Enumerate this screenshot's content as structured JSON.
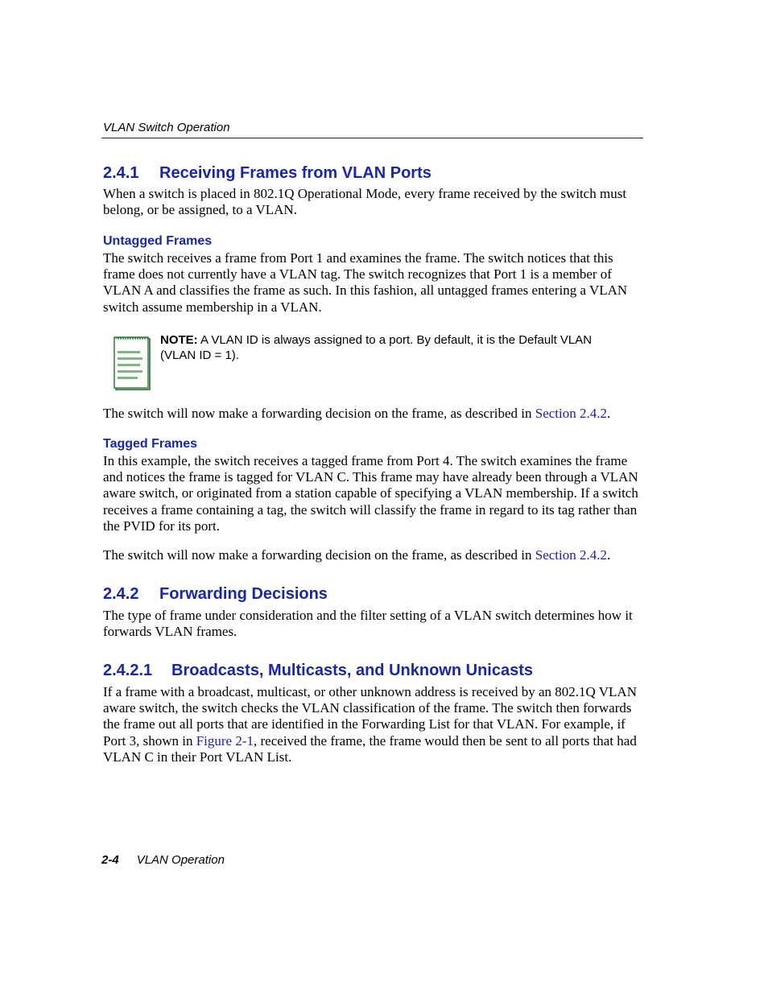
{
  "running_header": "VLAN Switch Operation",
  "section_241": {
    "number": "2.4.1",
    "title": "Receiving Frames from VLAN Ports",
    "paragraph": [
      "When a switch is placed in 802.1Q Operational Mode, every frame received by the switch must",
      "belong, or be assigned, to a VLAN."
    ]
  },
  "untagged": {
    "title": "Untagged Frames",
    "paragraph": [
      "The switch receives a frame from Port 1 and examines the frame. The switch notices that this",
      "frame does not currently have a VLAN tag. The switch recognizes that Port 1 is a member of",
      "VLAN A and classifies the frame as such. In this fashion, all untagged frames entering a VLAN",
      "switch assume membership in a VLAN."
    ],
    "note": {
      "label": "NOTE:",
      "line1": " A VLAN ID is always assigned to a port. By default, it is the Default VLAN",
      "line2": "(VLAN ID = 1)."
    },
    "followup_prefix": "The switch will now make a forwarding decision on the frame, as described in ",
    "followup_link": "Section 2.4.2",
    "followup_suffix": "."
  },
  "tagged": {
    "title": "Tagged Frames",
    "paragraph": [
      "In this example, the switch receives a tagged frame from Port 4. The switch examines the frame",
      "and notices the frame is tagged for VLAN C. This frame may have already been through a VLAN",
      "aware switch, or originated from a station capable of specifying a VLAN membership. If a switch",
      "receives a frame containing a tag, the switch will classify the frame in regard to its tag rather than",
      "the PVID for its port."
    ],
    "followup_prefix": "The switch will now make a forwarding decision on the frame, as described in ",
    "followup_link": "Section 2.4.2",
    "followup_suffix": "."
  },
  "section_242": {
    "number": "2.4.2",
    "title": "Forwarding Decisions",
    "paragraph": [
      "The type of frame under consideration and the filter setting of a VLAN switch determines how it",
      "forwards VLAN frames."
    ]
  },
  "section_2421": {
    "number": "2.4.2.1",
    "title": "Broadcasts, Multicasts, and Unknown Unicasts",
    "line1": "If a frame with a broadcast, multicast, or other unknown address is received by an 802.1Q VLAN",
    "line2": "aware switch, the switch checks the VLAN classification of the frame. The switch then forwards",
    "line3": "the frame out all ports that are identified in the Forwarding List for that VLAN. For example, if",
    "line4_prefix": "Port 3, shown in ",
    "line4_link": "Figure 2-1",
    "line4_suffix": ", received the frame, the frame would then be sent to all ports that had",
    "line5": "VLAN C in their Port VLAN List."
  },
  "footer": {
    "page_number": "2-4",
    "title": "VLAN Operation"
  },
  "icons": {
    "note": "notepad-icon"
  },
  "colors": {
    "heading": "#1626b4",
    "link": "#1a1acc",
    "note_icon": "#2e7d32"
  }
}
